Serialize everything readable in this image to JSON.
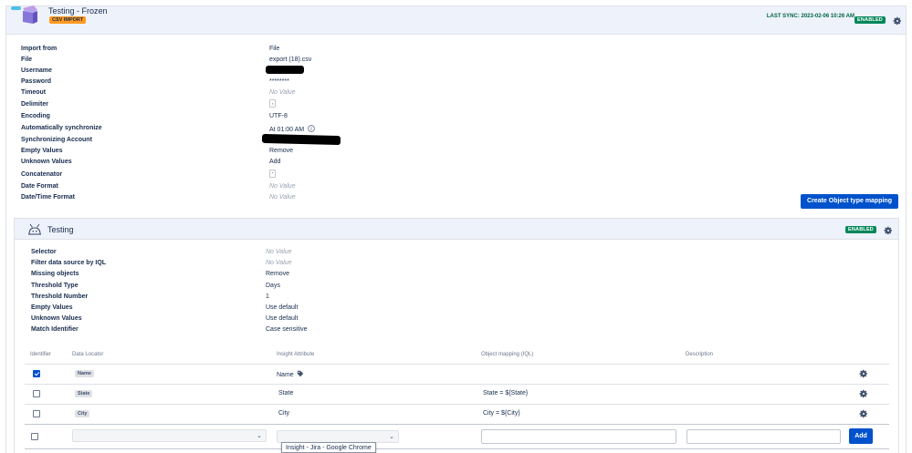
{
  "import": {
    "title": "Testing - Frozen",
    "type_badge": "CSV IMPORT",
    "last_sync": "LAST SYNC: 2023-02-06 10:26 AM",
    "status": "ENABLED",
    "properties": [
      {
        "label": "Import from",
        "value": "File",
        "muted": false
      },
      {
        "label": "File",
        "value": "export (18).csv",
        "muted": false
      },
      {
        "label": "Username",
        "value": "",
        "muted": false,
        "redacted": true
      },
      {
        "label": "Password",
        "value": "********",
        "muted": false
      },
      {
        "label": "Timeout",
        "value": "No Value",
        "muted": true
      },
      {
        "label": "Delimiter",
        "value": ",",
        "muted": false,
        "boxed": true
      },
      {
        "label": "Encoding",
        "value": "UTF-8",
        "muted": false
      },
      {
        "label": "Automatically synchronize",
        "value": "At 01:00 AM",
        "muted": false,
        "info": true
      },
      {
        "label": "Synchronizing Account",
        "value": "",
        "muted": false,
        "redacted": true
      },
      {
        "label": "Empty Values",
        "value": "Remove",
        "muted": false
      },
      {
        "label": "Unknown Values",
        "value": "Add",
        "muted": false
      },
      {
        "label": "Concatenator",
        "value": "-",
        "muted": false,
        "boxed": true
      },
      {
        "label": "Date Format",
        "value": "No Value",
        "muted": true
      },
      {
        "label": "Date/Time Format",
        "value": "No Value",
        "muted": true
      }
    ],
    "create_mapping_label": "Create Object type mapping"
  },
  "object_type": {
    "title": "Testing",
    "status": "ENABLED",
    "properties": [
      {
        "label": "Selector",
        "value": "No Value",
        "muted": true
      },
      {
        "label": "Filter data source by IQL",
        "value": "No Value",
        "muted": true
      },
      {
        "label": "Missing objects",
        "value": "Remove",
        "muted": false
      },
      {
        "label": "Threshold Type",
        "value": "Days",
        "muted": false
      },
      {
        "label": "Threshold Number",
        "value": "1",
        "muted": false
      },
      {
        "label": "Empty Values",
        "value": "Use default",
        "muted": false
      },
      {
        "label": "Unknown Values",
        "value": "Use default",
        "muted": false
      },
      {
        "label": "Match Identifier",
        "value": "Case sensitive",
        "muted": false
      }
    ],
    "table": {
      "headers": {
        "identifier": "Identifier",
        "data_locator": "Data Locator",
        "insight_attribute": "Insight Attribute",
        "object_mapping": "Object mapping (IQL)",
        "description": "Description"
      },
      "rows": [
        {
          "identifier": true,
          "locator": "Name",
          "attribute": "Name",
          "mapping": "",
          "description": "",
          "label_icon": true
        },
        {
          "identifier": false,
          "locator": "State",
          "attribute": "State",
          "mapping": "State = ${State}",
          "description": ""
        },
        {
          "identifier": false,
          "locator": "City",
          "attribute": "City",
          "mapping": "City = ${City}",
          "description": ""
        }
      ],
      "new_row": {
        "mapping_value": "",
        "description_value": ""
      },
      "add_label": "Add"
    }
  },
  "tooltip": "Insight - Jira - Google Chrome"
}
